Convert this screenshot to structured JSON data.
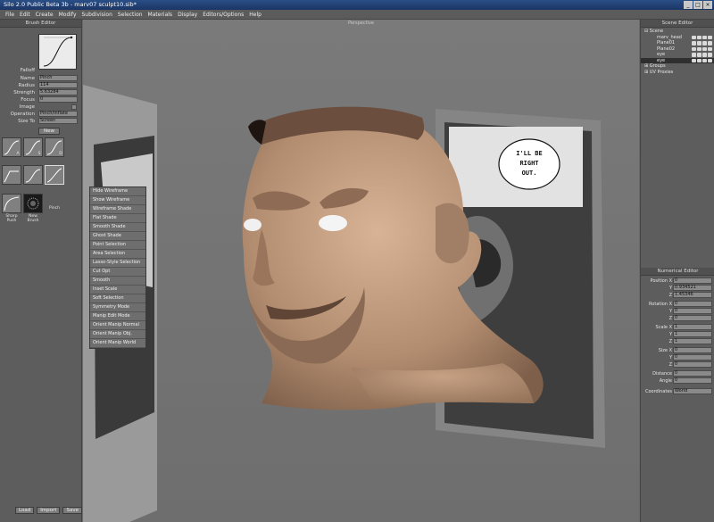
{
  "window": {
    "title": "Silo 2.0 Public Beta 3b - marv07 sculpt10.sib*",
    "buttons": [
      "_",
      "□",
      "×"
    ]
  },
  "menu": [
    "File",
    "Edit",
    "Create",
    "Modify",
    "Subdivision",
    "Selection",
    "Materials",
    "Display",
    "Editors/Options",
    "Help"
  ],
  "brush_editor": {
    "title": "Brush Editor",
    "falloff_label": "Falloff",
    "name_label": "Name",
    "name_value": "Pinch",
    "radius_label": "Radius",
    "radius_value": "114",
    "strength_label": "Strength",
    "strength_value": "5.63284",
    "focus_label": "Focus",
    "focus_value": "0",
    "image_label": "Image",
    "operation_label": "Operation",
    "operation_value": "Pinch/Inflate",
    "size_to_label": "Size To",
    "size_to_value": "Screen",
    "new_label": "New",
    "brushes": [
      "Push",
      "Smooth",
      "Move",
      "Flatten",
      "Smudge",
      "Pinch",
      "Sharp Push",
      "New Brush"
    ],
    "brush_keys": [
      "A",
      "S",
      "D"
    ],
    "load_label": "Load",
    "import_label": "Import",
    "save_label": "Save"
  },
  "viewport": {
    "label": "Perspective",
    "speech_bubble": [
      "I'LL BE",
      "RIGHT",
      "OUT."
    ],
    "context_menu": [
      "Hide Wireframe",
      "Show Wireframe",
      "Wireframe Shade",
      "Flat Shade",
      "Smooth Shade",
      "Ghost Shade",
      "Point Selection",
      "Area Selection",
      "Lasso-Style Selection",
      "Cut Opt",
      "Smooth",
      "Inset Scale",
      "Soft Selection",
      "Symmetry Mode",
      "Manip Edit Mode",
      "Orient Manip Normal",
      "Orient Manip Obj.",
      "Orient Manip World"
    ]
  },
  "scene_editor": {
    "title": "Scene Editor",
    "scene_label": "Scene",
    "objects": [
      "marv_head",
      "Plane01",
      "Plane02",
      "eye",
      "eye"
    ],
    "groups_label": "Groups",
    "uv_label": "UV Proxies"
  },
  "numeric_editor": {
    "title": "Numerical Editor",
    "position_label": "Position",
    "rotation_label": "Rotation",
    "scale_label": "Scale",
    "size_label": "Size",
    "axes": [
      "X",
      "Y",
      "Z"
    ],
    "position_values": [
      "0",
      "0.934521",
      "1.45346"
    ],
    "rotation_values": [
      "0",
      "0",
      "0"
    ],
    "scale_values": [
      "1",
      "1",
      "1"
    ],
    "size_values": [
      "0",
      "0",
      "0"
    ],
    "distance_label": "Distance",
    "distance_value": "0",
    "angle_label": "Angle",
    "angle_value": "0",
    "coordinates_label": "Coordinates",
    "coordinates_value": "World"
  }
}
